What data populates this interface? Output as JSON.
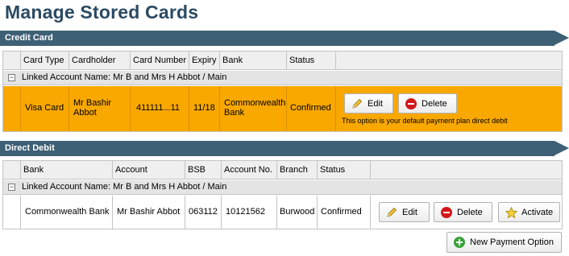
{
  "page": {
    "title": "Manage Stored Cards"
  },
  "credit": {
    "section_title": "Credit Card",
    "columns": [
      "Card Type",
      "Cardholder",
      "Card Number",
      "Expiry",
      "Bank",
      "Status"
    ],
    "group_label": "Linked Account Name: Mr B and Mrs H Abbot / Main",
    "row": {
      "card_type": "Visa Card",
      "cardholder_line1": "Mr Bashir",
      "cardholder_line2": "Abbot",
      "card_number": "411111...11",
      "expiry": "11/18",
      "bank_line1": "Commonwealth",
      "bank_line2": "Bank",
      "status": "Confirmed",
      "edit_label": "Edit",
      "delete_label": "Delete",
      "note": "This option is your default payment plan direct debit",
      "highlight_color": "#f9a800"
    }
  },
  "debit": {
    "section_title": "Direct Debit",
    "columns": [
      "Bank",
      "Account",
      "BSB",
      "Account No.",
      "Branch",
      "Status"
    ],
    "group_label": "Linked Account Name: Mr B and Mrs H Abbot / Main",
    "row": {
      "bank": "Commonwealth Bank",
      "account": "Mr Bashir Abbot",
      "bsb": "063112",
      "account_no": "10121562",
      "branch": "Burwood",
      "status": "Confirmed",
      "edit_label": "Edit",
      "delete_label": "Delete",
      "activate_label": "Activate"
    }
  },
  "footer": {
    "new_payment_label": "New Payment Option"
  },
  "colors": {
    "title": "#2a4a63",
    "section_bar": "#3d6075"
  }
}
